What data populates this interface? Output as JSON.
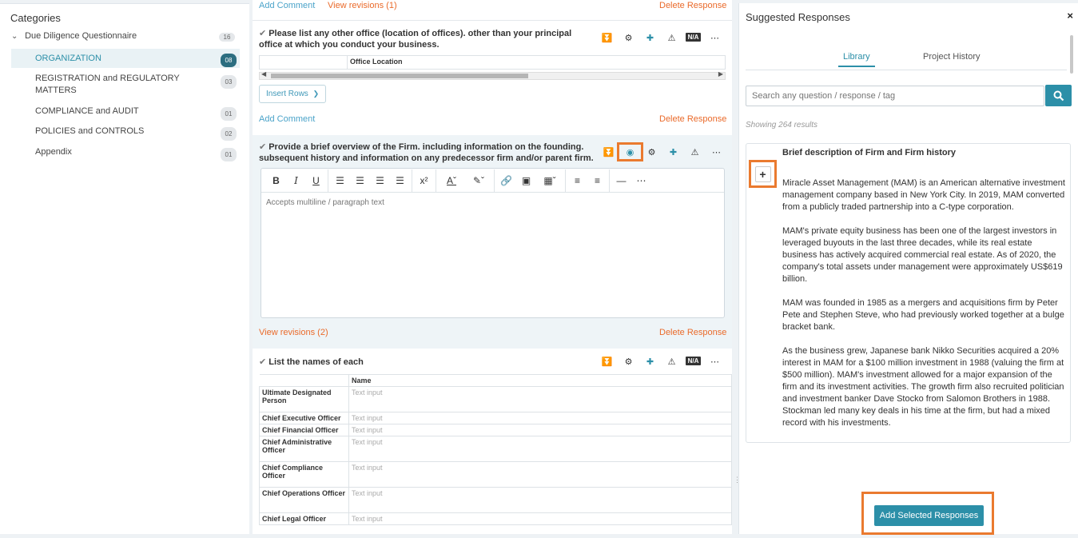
{
  "categories": {
    "title": "Categories",
    "root": {
      "label": "Due Diligence Questionnaire",
      "count": "16"
    },
    "items": [
      {
        "label": "ORGANIZATION",
        "count": "08",
        "active": true
      },
      {
        "label": "REGISTRATION and REGULATORY MATTERS",
        "count": "03"
      },
      {
        "label": "COMPLIANCE and AUDIT",
        "count": "01"
      },
      {
        "label": "POLICIES and CONTROLS",
        "count": "02"
      },
      {
        "label": "Appendix",
        "count": "01"
      }
    ]
  },
  "middle": {
    "top_links": {
      "add_comment": "Add Comment",
      "view_revisions": "View revisions (1)",
      "delete_response": "Delete Response"
    },
    "q1": {
      "text": "Please list any other office (location of offices). other than your principal office at which you conduct your business.",
      "column": "Office Location",
      "insert_rows": "Insert Rows",
      "add_comment": "Add Comment",
      "delete_response": "Delete Response",
      "na": "N/A"
    },
    "q2": {
      "text": "Provide a brief overview of the Firm. including information on the founding. subsequent history and information on any predecessor firm and/or parent firm.",
      "placeholder": "Accepts multiline / paragraph text",
      "view_revisions": "View revisions (2)",
      "delete_response": "Delete Response"
    },
    "q3": {
      "text": "List the names of each",
      "column": "Name",
      "na": "N/A",
      "placeholder": "Text input",
      "rows": [
        "Ultimate Designated Person",
        "Chief Executive Officer",
        "Chief Financial Officer",
        "Chief Administrative Officer",
        "Chief Compliance Officer",
        "Chief Operations Officer",
        "Chief Legal Officer"
      ]
    }
  },
  "suggested": {
    "title": "Suggested Responses",
    "close": "×",
    "tabs": [
      "Library",
      "Project History"
    ],
    "search_placeholder": "Search any question / response / tag",
    "showing": "Showing 264 results",
    "card": {
      "title": "Brief description of Firm and Firm history",
      "paragraphs": [
        "Miracle Asset Management (MAM) is an American alternative investment management company based in New York City. In 2019, MAM converted from a publicly traded partnership into a C-type corporation.",
        "MAM's private equity business has been one of the largest investors in leveraged buyouts in the last three decades, while its real estate business has actively acquired commercial real estate. As of 2020, the company's total assets under management were approximately US$619 billion.",
        "MAM was founded in 1985 as a mergers and acquisitions firm by Peter Pete and Stephen Steve, who had previously worked together at a bulge bracket bank.",
        "As the business grew, Japanese bank Nikko Securities acquired a 20% interest in MAM for a $100 million investment in 1988 (valuing the firm at $500 million). MAM's investment allowed for a major expansion of the firm and its investment activities. The growth firm also recruited politician and investment banker Dave Stocko from Salomon Brothers in 1988. Stockman led many key deals in his time at the firm, but had a mixed record with his investments."
      ]
    },
    "add_button": "Add Selected Responses"
  },
  "colors": {
    "teal": "#2c8fa8",
    "orange": "#ea6a2a",
    "highlight": "#ea7a2f"
  }
}
